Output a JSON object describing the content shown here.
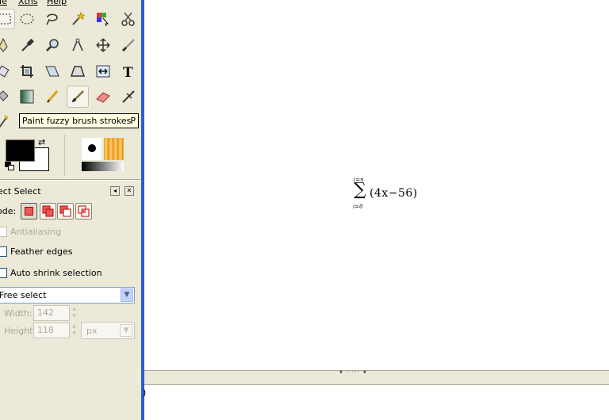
{
  "menubar": {
    "file": "ile",
    "xtns": "Xtns",
    "help": "Help"
  },
  "toolbox": {
    "tools_row1": [
      "rect-select-icon",
      "ellipse-select-icon",
      "lasso-icon",
      "magic-wand-icon",
      "color-select-icon",
      "scissors-icon"
    ],
    "tools_row2": [
      "paths-icon",
      "color-picker-icon",
      "magnify-icon",
      "measure-icon",
      "move-icon",
      "knife-icon"
    ],
    "tools_row3": [
      "rotate-icon",
      "crop-icon",
      "shear-icon",
      "perspective-icon",
      "flip-icon",
      "text-icon"
    ],
    "tools_row4": [
      "bucket-fill-icon",
      "blend-icon",
      "pencil-icon",
      "paintbrush-icon",
      "eraser-icon",
      "airbrush-icon"
    ],
    "tooltip": {
      "text": "Paint fuzzy brush strokes",
      "shortcut": "P"
    }
  },
  "colors": {
    "foreground": "#000000",
    "background": "#ffffff"
  },
  "tool_options": {
    "title": "ect Select",
    "mode_label": "ode:",
    "antialiasing": {
      "label": "Antialiasing",
      "checked": false,
      "enabled": false
    },
    "feather_edges": {
      "label": "Feather edges",
      "checked": false,
      "enabled": true
    },
    "auto_shrink": {
      "label": "Auto shrink selection",
      "checked": false,
      "enabled": true
    },
    "select_mode_value": "Free select",
    "width_label": "Width:",
    "width_value": "142",
    "height_label": "Height:",
    "height_value": "118",
    "unit_value": "px"
  },
  "canvas": {
    "sum_upper": "i=n",
    "sum_lower": "i=0",
    "sum_expression": "(4x−56)"
  },
  "lower_panel": {
    "text": ")"
  },
  "pane_handle_dots": "▾ ····· ▾"
}
